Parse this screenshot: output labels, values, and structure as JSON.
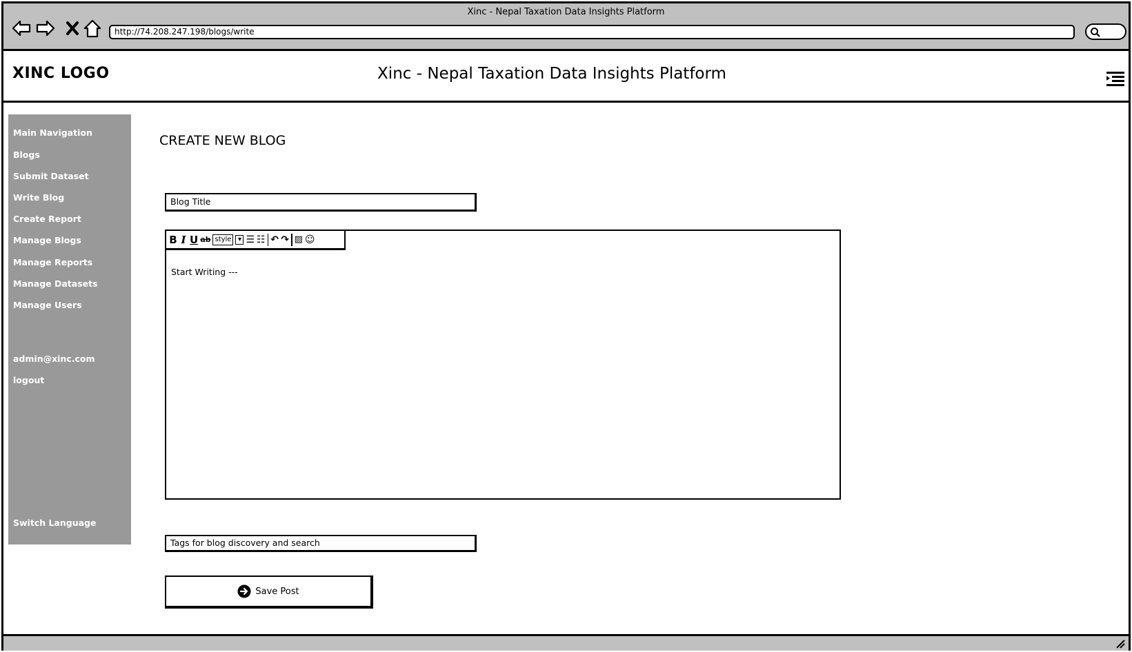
{
  "browser": {
    "window_title": "Xinc - Nepal Taxation Data Insights Platform",
    "url": "http://74.208.247.198/blogs/write",
    "nav_icons": [
      "back-arrow-icon",
      "forward-arrow-icon",
      "close-x-icon",
      "home-icon"
    ],
    "search_icon": "search-icon"
  },
  "header": {
    "logo": "XINC LOGO",
    "title": "Xinc - Nepal Taxation Data Insights Platform",
    "menu_icon": "hamburger-menu-icon"
  },
  "sidebar": {
    "nav_heading": "Main Navigation",
    "items": [
      {
        "label": "Blogs"
      },
      {
        "label": "Submit Dataset"
      },
      {
        "label": "Write Blog"
      },
      {
        "label": "Create Report"
      },
      {
        "label": "Manage Blogs"
      },
      {
        "label": "Manage Reports"
      },
      {
        "label": "Manage Datasets"
      },
      {
        "label": "Manage Users"
      }
    ],
    "user_email": "admin@xinc.com",
    "logout": "logout",
    "switch_language": "Switch Language"
  },
  "main": {
    "heading": "CREATE NEW BLOG",
    "title_input": {
      "value": "Blog Title"
    },
    "editor": {
      "toolbar_style_label": "style",
      "content": "Start Writing ---"
    },
    "tags_input": {
      "value": "Tags for blog discovery and search"
    },
    "save_button": {
      "label": "Save Post",
      "icon": "arrow-right-circle-icon"
    }
  },
  "colors": {
    "chrome": "#c0c0c0",
    "sidebar": "#999999",
    "border": "#000000"
  }
}
